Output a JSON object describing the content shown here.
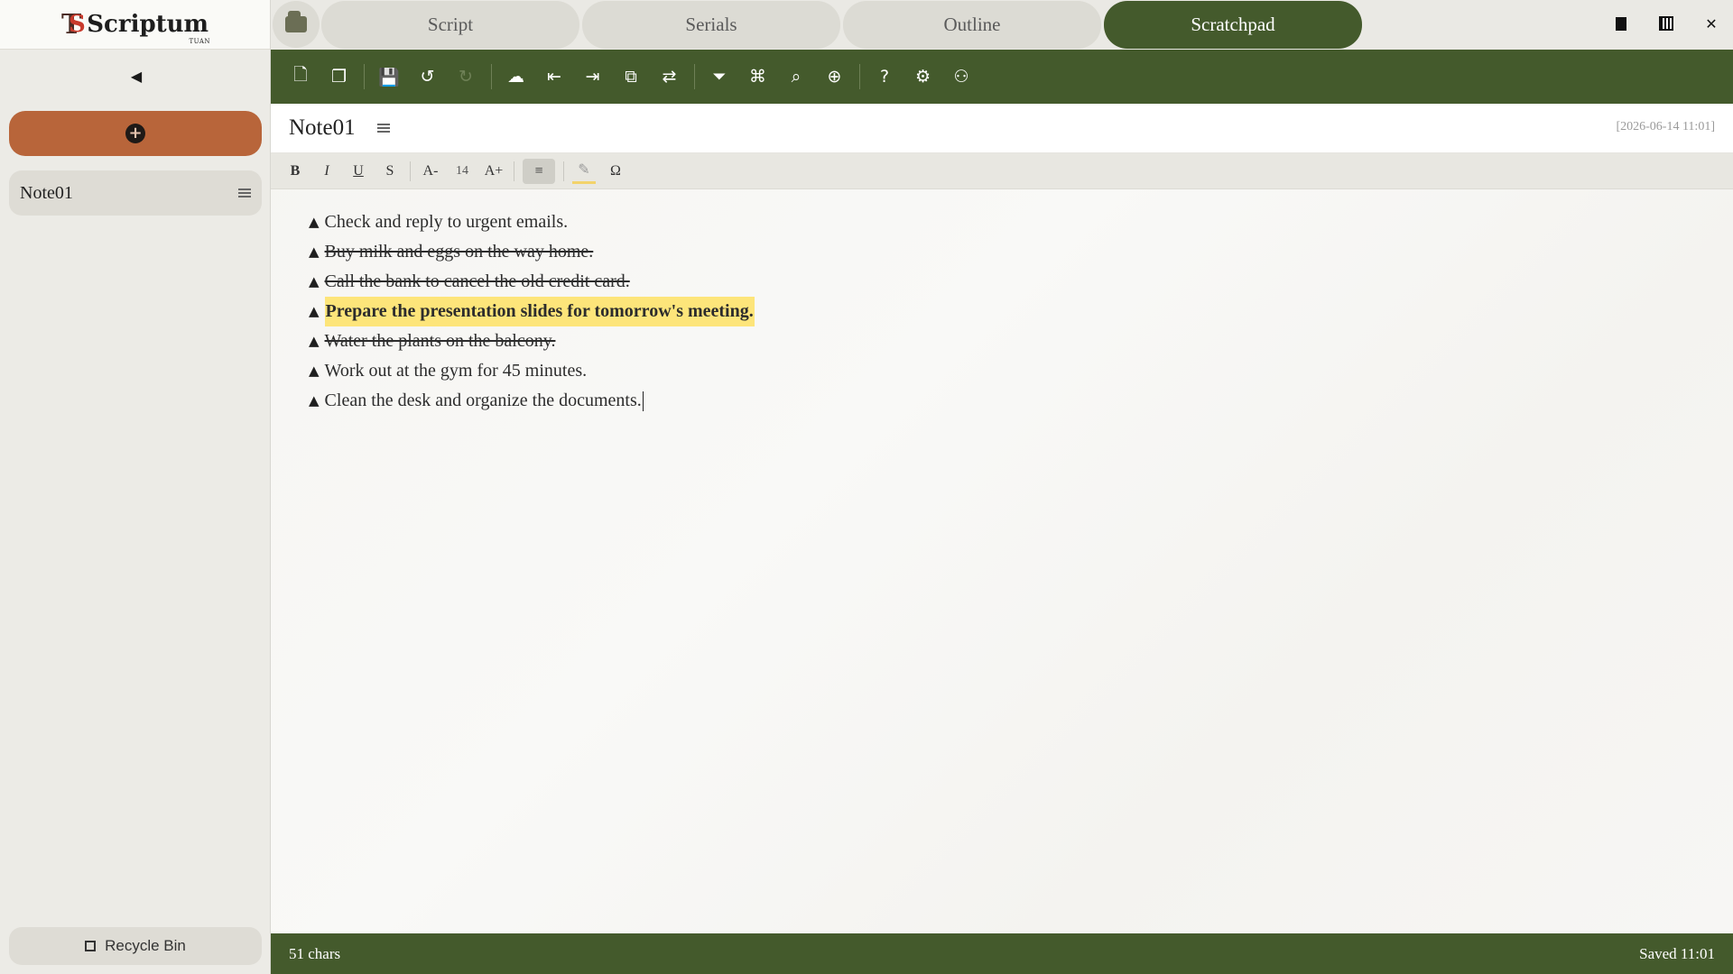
{
  "app": {
    "logo_text": "Scriptum",
    "logo_mark": "T",
    "logo_mark_s": "S",
    "logo_sub": "TUAN"
  },
  "sidebar": {
    "collapse_icon": "◀",
    "add_icon": "+",
    "notes": [
      {
        "label": "Note01"
      }
    ],
    "recycle_bin_label": "Recycle Bin"
  },
  "tabs": [
    {
      "label": "Script"
    },
    {
      "label": "Serials"
    },
    {
      "label": "Outline"
    },
    {
      "label": "Scratchpad"
    }
  ],
  "active_tab": "Scratchpad",
  "window_controls": {
    "close": "✕"
  },
  "toolbar": {
    "icons": [
      "new-note-icon",
      "copy-icon",
      "save-icon",
      "undo-icon",
      "redo-icon",
      "cloud-icon",
      "import-icon",
      "export-icon",
      "translate-icon",
      "sync-icon",
      "filter-icon",
      "tag-icon",
      "search-icon",
      "zoom-search-icon",
      "help-icon",
      "settings-icon",
      "user-icon"
    ]
  },
  "note": {
    "title": "Note01",
    "date": "[2026-06-14 11:01]"
  },
  "format": {
    "bold": "B",
    "italic": "I",
    "underline": "U",
    "strike": "S",
    "font_down": "A-",
    "font_size": "14",
    "font_up": "A+",
    "align": "≡",
    "highlight": "✎",
    "special_char": "Ω"
  },
  "content": {
    "bullet": "▲",
    "lines": [
      {
        "text": "Check and reply to urgent emails.",
        "style": "normal"
      },
      {
        "text": "Buy milk and eggs on the way home.",
        "style": "strike"
      },
      {
        "text": "Call the bank to cancel the old credit card.",
        "style": "strike"
      },
      {
        "text": "Prepare the presentation slides for tomorrow's meeting.",
        "style": "highlight"
      },
      {
        "text": "Water the plants on the balcony.",
        "style": "strike"
      },
      {
        "text": "Work out at the gym for 45 minutes.",
        "style": "normal"
      },
      {
        "text": "Clean the desk and organize the documents.",
        "style": "normal"
      }
    ]
  },
  "status": {
    "chars": "51 chars",
    "saved": "Saved 11:01"
  },
  "colors": {
    "accent_green": "#445a2c",
    "add_button": "#b8653a",
    "highlight": "#fde57a"
  }
}
